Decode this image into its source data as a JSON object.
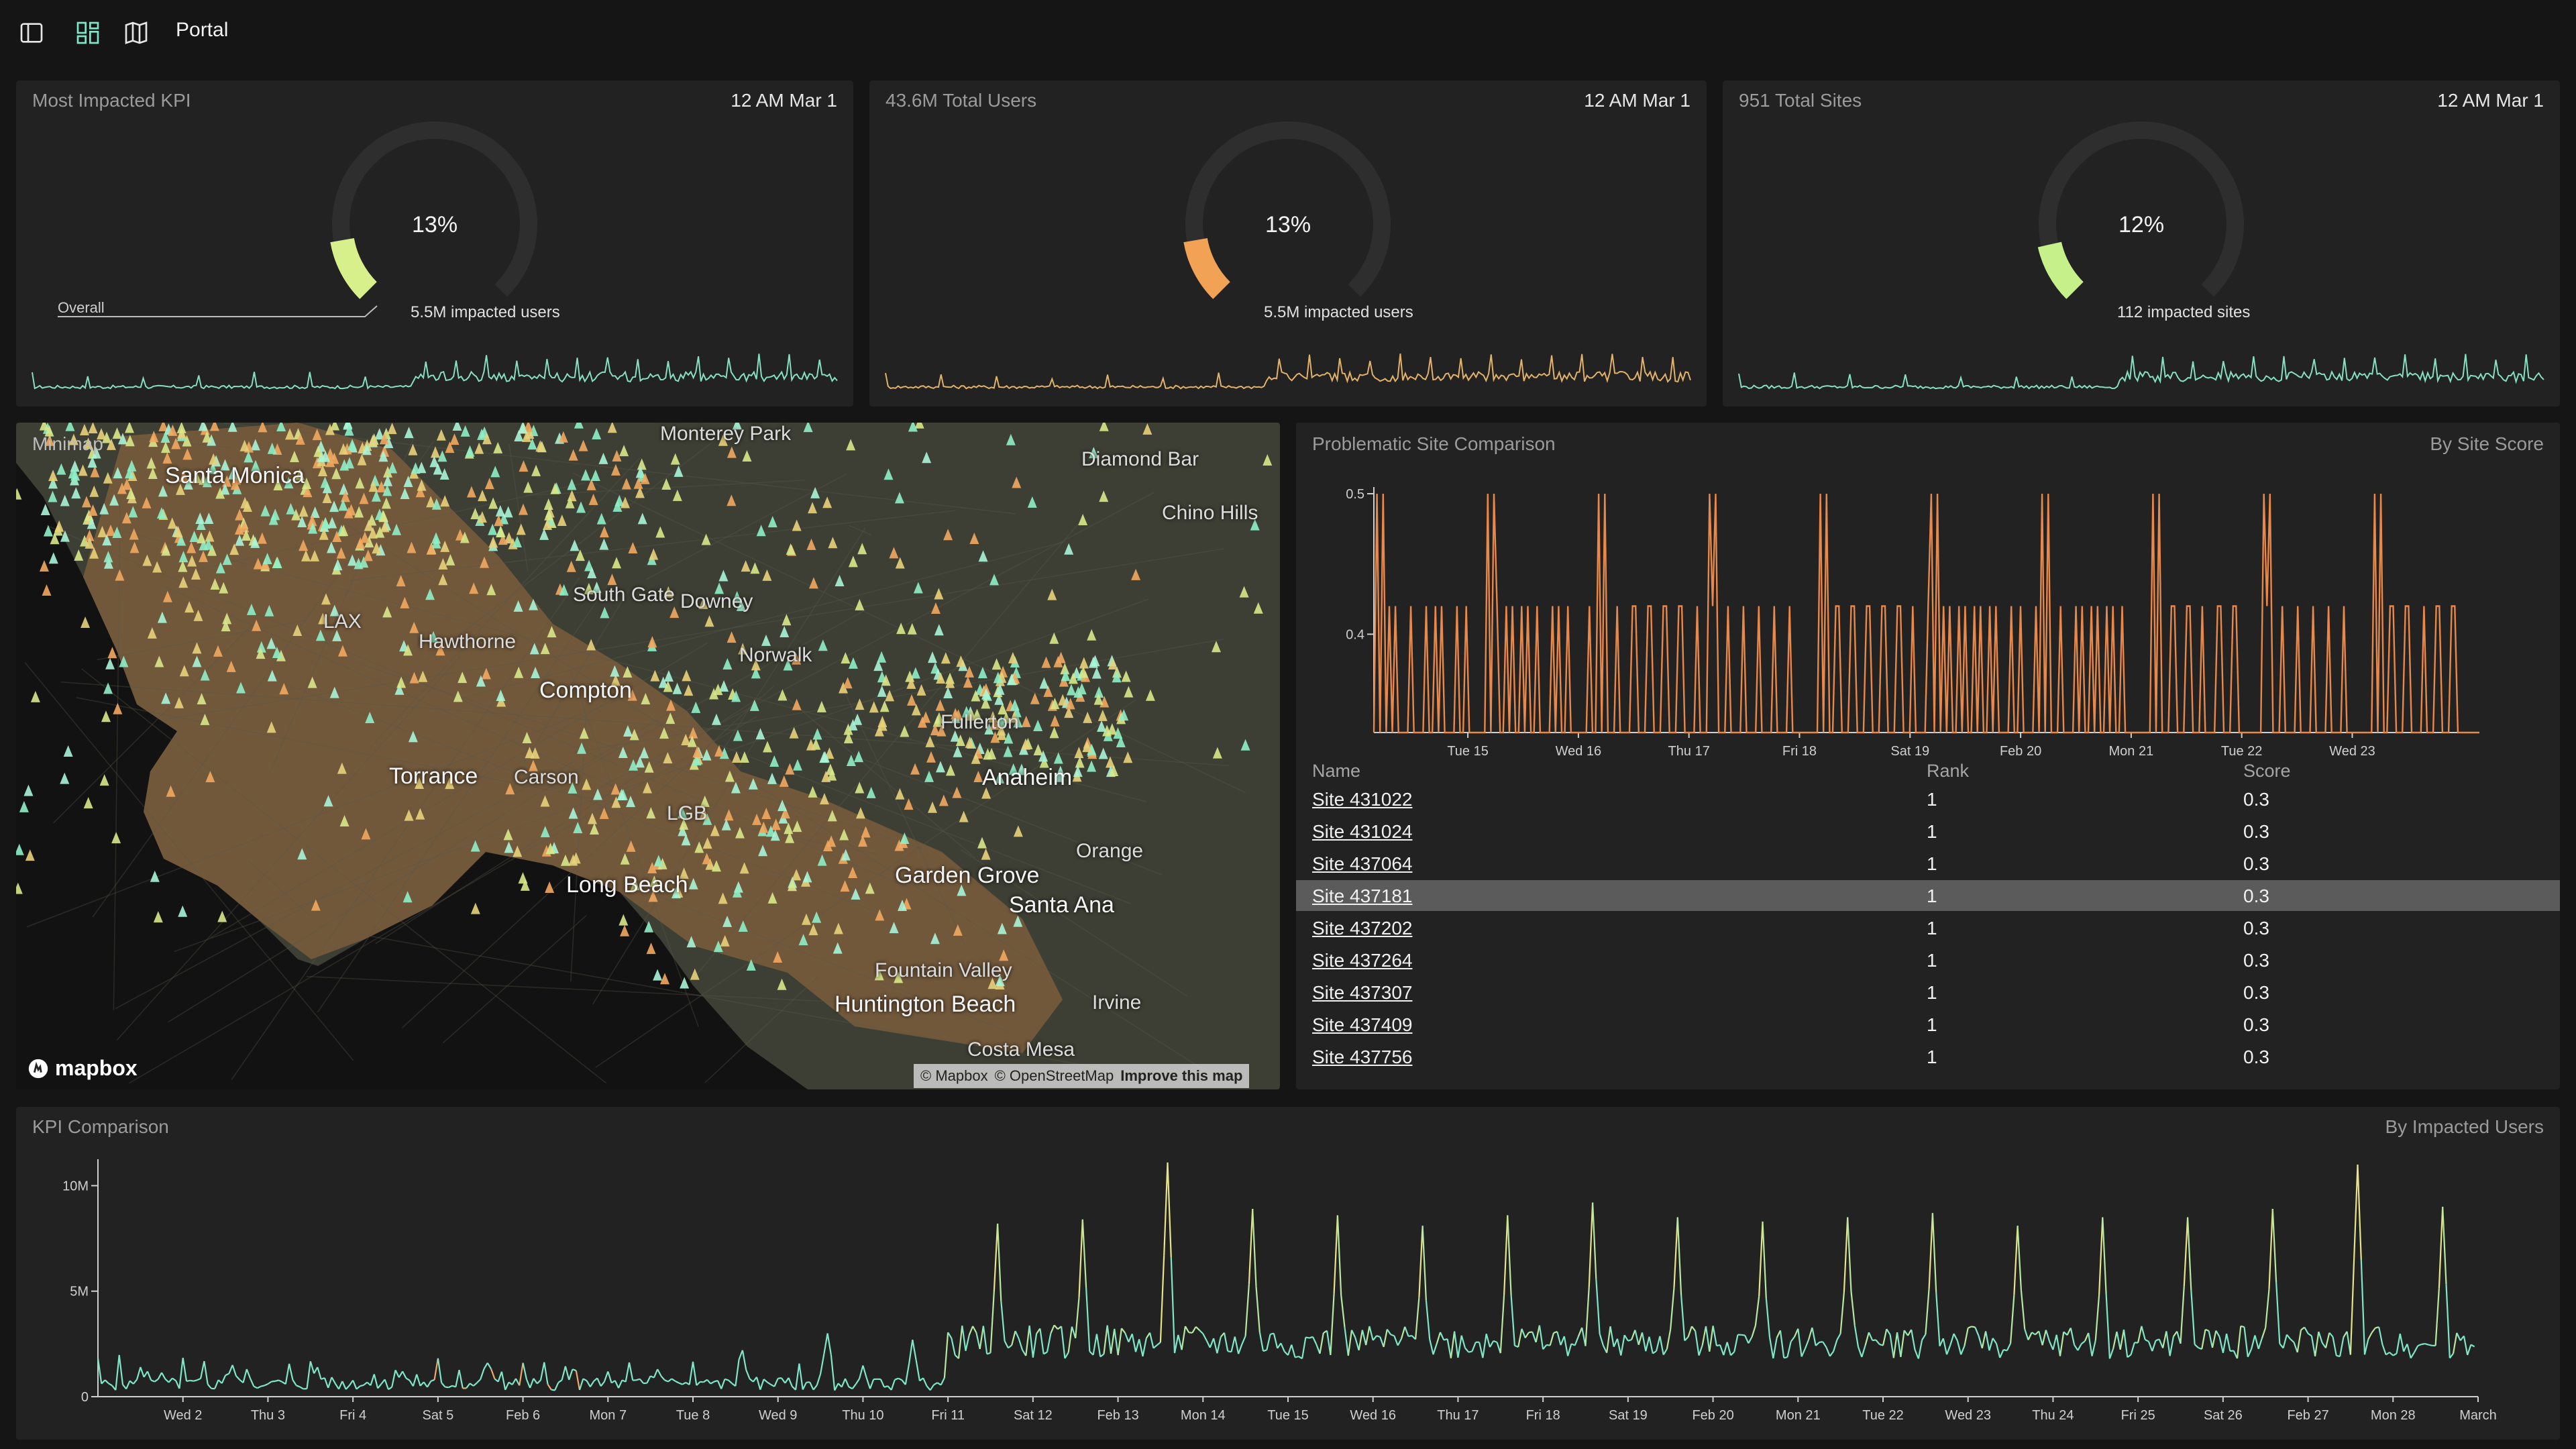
{
  "app": {
    "title": "Portal"
  },
  "cards": [
    {
      "label": "Most Impacted KPI",
      "time": "12 AM Mar 1",
      "percent": "13%",
      "fraction": 0.13,
      "sub": "5.5M impacted users",
      "overall_label": "Overall",
      "color": "#d8f08c"
    },
    {
      "label": "43.6M Total Users",
      "time": "12 AM Mar 1",
      "percent": "13%",
      "fraction": 0.13,
      "sub": "5.5M impacted users",
      "color": "#f1a254"
    },
    {
      "label": "951 Total Sites",
      "time": "12 AM Mar 1",
      "percent": "12%",
      "fraction": 0.12,
      "sub": "112 impacted sites",
      "color": "#c6f08a"
    }
  ],
  "map": {
    "label": "Minimap",
    "cities": [
      "Santa Monica",
      "Monterey Park",
      "Diamond Bar",
      "Chino Hills",
      "South Gate",
      "Downey",
      "Hawthorne",
      "LAX",
      "Norwalk",
      "Compton",
      "Fullerton",
      "Torrance",
      "Carson",
      "Anaheim",
      "LGB",
      "Long Beach",
      "Garden Grove",
      "Orange",
      "Santa Ana",
      "Fountain Valley",
      "Huntington Beach",
      "Irvine",
      "Costa Mesa"
    ],
    "logo": "mapbox",
    "attribution": [
      "© Mapbox",
      "© OpenStreetMap",
      "Improve this map"
    ]
  },
  "site_comparison": {
    "title": "Problematic Site Comparison",
    "sort": "By Site Score",
    "columns": [
      "Name",
      "Rank",
      "Score"
    ],
    "rows": [
      {
        "name": "Site 431022",
        "rank": "1",
        "score": "0.3"
      },
      {
        "name": "Site 431024",
        "rank": "1",
        "score": "0.3"
      },
      {
        "name": "Site 437064",
        "rank": "1",
        "score": "0.3"
      },
      {
        "name": "Site 437181",
        "rank": "1",
        "score": "0.3",
        "selected": true
      },
      {
        "name": "Site 437202",
        "rank": "1",
        "score": "0.3"
      },
      {
        "name": "Site 437264",
        "rank": "1",
        "score": "0.3"
      },
      {
        "name": "Site 437307",
        "rank": "1",
        "score": "0.3"
      },
      {
        "name": "Site 437409",
        "rank": "1",
        "score": "0.3"
      },
      {
        "name": "Site 437756",
        "rank": "1",
        "score": "0.3"
      }
    ]
  },
  "kpi_comparison": {
    "title": "KPI Comparison",
    "sort": "By Impacted Users"
  },
  "chart_data": [
    {
      "type": "line",
      "title": "Problematic Site Comparison",
      "ylim": [
        0.33,
        0.5
      ],
      "yticks": [
        "0.4",
        "0.5"
      ],
      "x_ticks": [
        "Tue 15",
        "Wed 16",
        "Thu 17",
        "Fri 18",
        "Sat 19",
        "Feb 20",
        "Mon 21",
        "Tue 22",
        "Wed 23"
      ],
      "series": [
        {
          "color": "#e8884a",
          "pattern": "spikes between 0.3 and 0.5, peaks daily"
        }
      ]
    },
    {
      "type": "line",
      "title": "KPI Comparison",
      "ylim": [
        0,
        11000000
      ],
      "yticks": [
        "0",
        "5M",
        "10M"
      ],
      "x_ticks": [
        "Wed 2",
        "Thu 3",
        "Fri 4",
        "Sat 5",
        "Feb 6",
        "Mon 7",
        "Tue 8",
        "Wed 9",
        "Thu 10",
        "Fri 11",
        "Sat 12",
        "Feb 13",
        "Mon 14",
        "Tue 15",
        "Wed 16",
        "Thu 17",
        "Fri 18",
        "Sat 19",
        "Feb 20",
        "Mon 21",
        "Tue 22",
        "Wed 23",
        "Thu 24",
        "Fri 25",
        "Sat 26",
        "Feb 27",
        "Mon 28",
        "March"
      ],
      "daily_peaks_millions": [
        1.2,
        1.5,
        1.4,
        1.2,
        1.6,
        1.3,
        1.3,
        2.2,
        3.0,
        2.7,
        8.2,
        8.4,
        11.1,
        8.9,
        8.6,
        8.1,
        8.6,
        9.2,
        8.5,
        8.3,
        8.5,
        8.7,
        8.1,
        8.5,
        8.5,
        8.9,
        11.0,
        9.0
      ],
      "colors": [
        "#7fe6c8",
        "#e7e38a",
        "#f0a86a"
      ]
    }
  ]
}
